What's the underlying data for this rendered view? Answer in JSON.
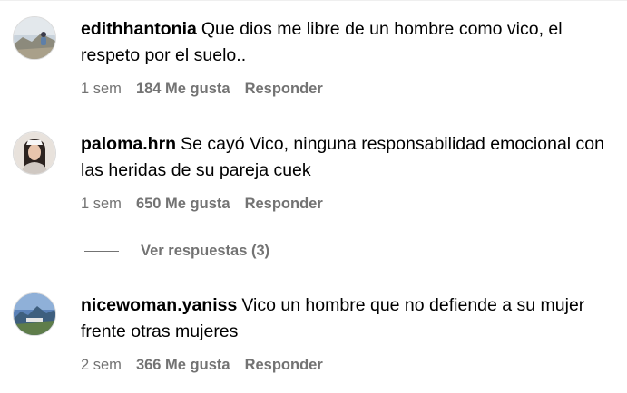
{
  "comments": [
    {
      "username": "edithhantonia",
      "text": "Que dios me libre de un hombre como vico, el respeto por el suelo..",
      "time": "1 sem",
      "likes": "184 Me gusta",
      "reply": "Responder"
    },
    {
      "username": "paloma.hrn",
      "text": "Se cayó Vico, ninguna responsabilidad emocional con las heridas de su pareja cuek",
      "time": "1 sem",
      "likes": "650 Me gusta",
      "reply": "Responder",
      "view_replies": "Ver respuestas (3)"
    },
    {
      "username": "nicewoman.yaniss",
      "text": "Vico un hombre que no defiende a su mujer frente otras mujeres",
      "time": "2 sem",
      "likes": "366 Me gusta",
      "reply": "Responder"
    }
  ],
  "colors": {
    "text": "#000000",
    "meta": "#737373"
  }
}
